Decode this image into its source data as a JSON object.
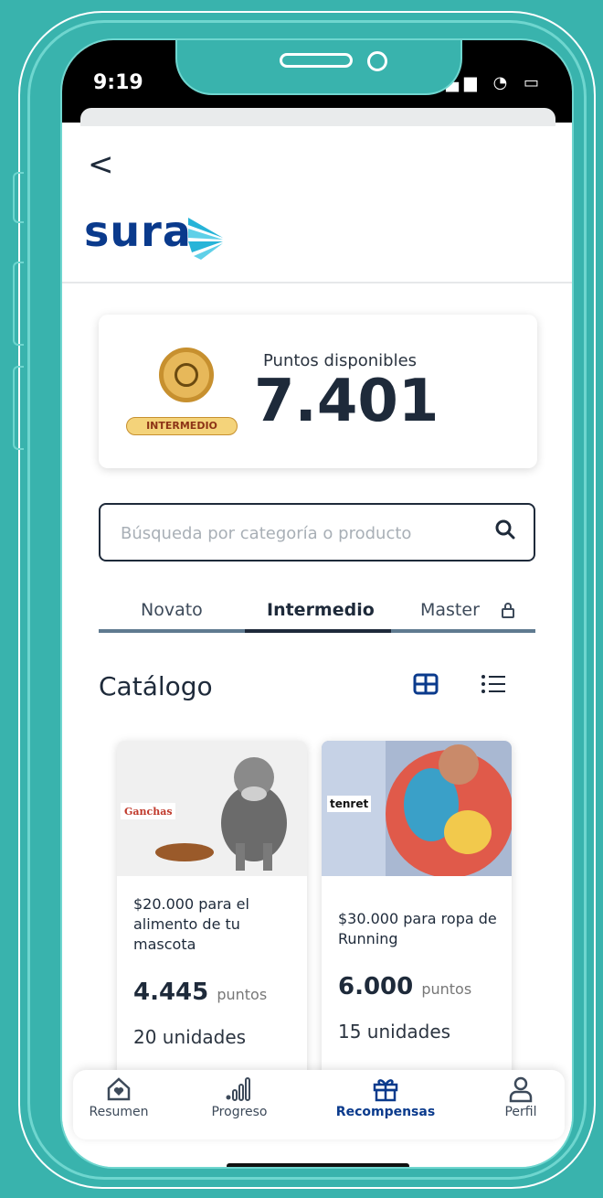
{
  "status_bar": {
    "time": "9:19",
    "signals": "▂▄▆ ◔ ▭"
  },
  "header": {
    "back_label": "<",
    "logo_text": "sura"
  },
  "points": {
    "label": "Puntos disponibles",
    "value": "7.401",
    "level_badge": "INTERMEDIO"
  },
  "search": {
    "placeholder": "Búsqueda por categoría o producto"
  },
  "tabs": [
    {
      "label": "Novato"
    },
    {
      "label": "Intermedio"
    },
    {
      "label": "Master"
    }
  ],
  "catalog": {
    "title": "Catálogo",
    "items": [
      {
        "brand": "Ganchas",
        "title": "$20.000 para el alimento de tu mascota",
        "points": "4.445",
        "points_unit": "puntos",
        "units": "20 unidades"
      },
      {
        "brand": "tenret",
        "title": "$30.000 para ropa de Running",
        "points": "6.000",
        "points_unit": "puntos",
        "units": "15 unidades"
      }
    ]
  },
  "bottom_nav": [
    {
      "label": "Resumen",
      "icon": "home-heart-icon"
    },
    {
      "label": "Progreso",
      "icon": "progress-bars-icon"
    },
    {
      "label": "Recompensas",
      "icon": "gift-icon"
    },
    {
      "label": "Perfil",
      "icon": "user-icon"
    }
  ],
  "colors": {
    "background": "#39b3ad",
    "accent": "#0a3a8c",
    "text": "#1e2a3a"
  }
}
